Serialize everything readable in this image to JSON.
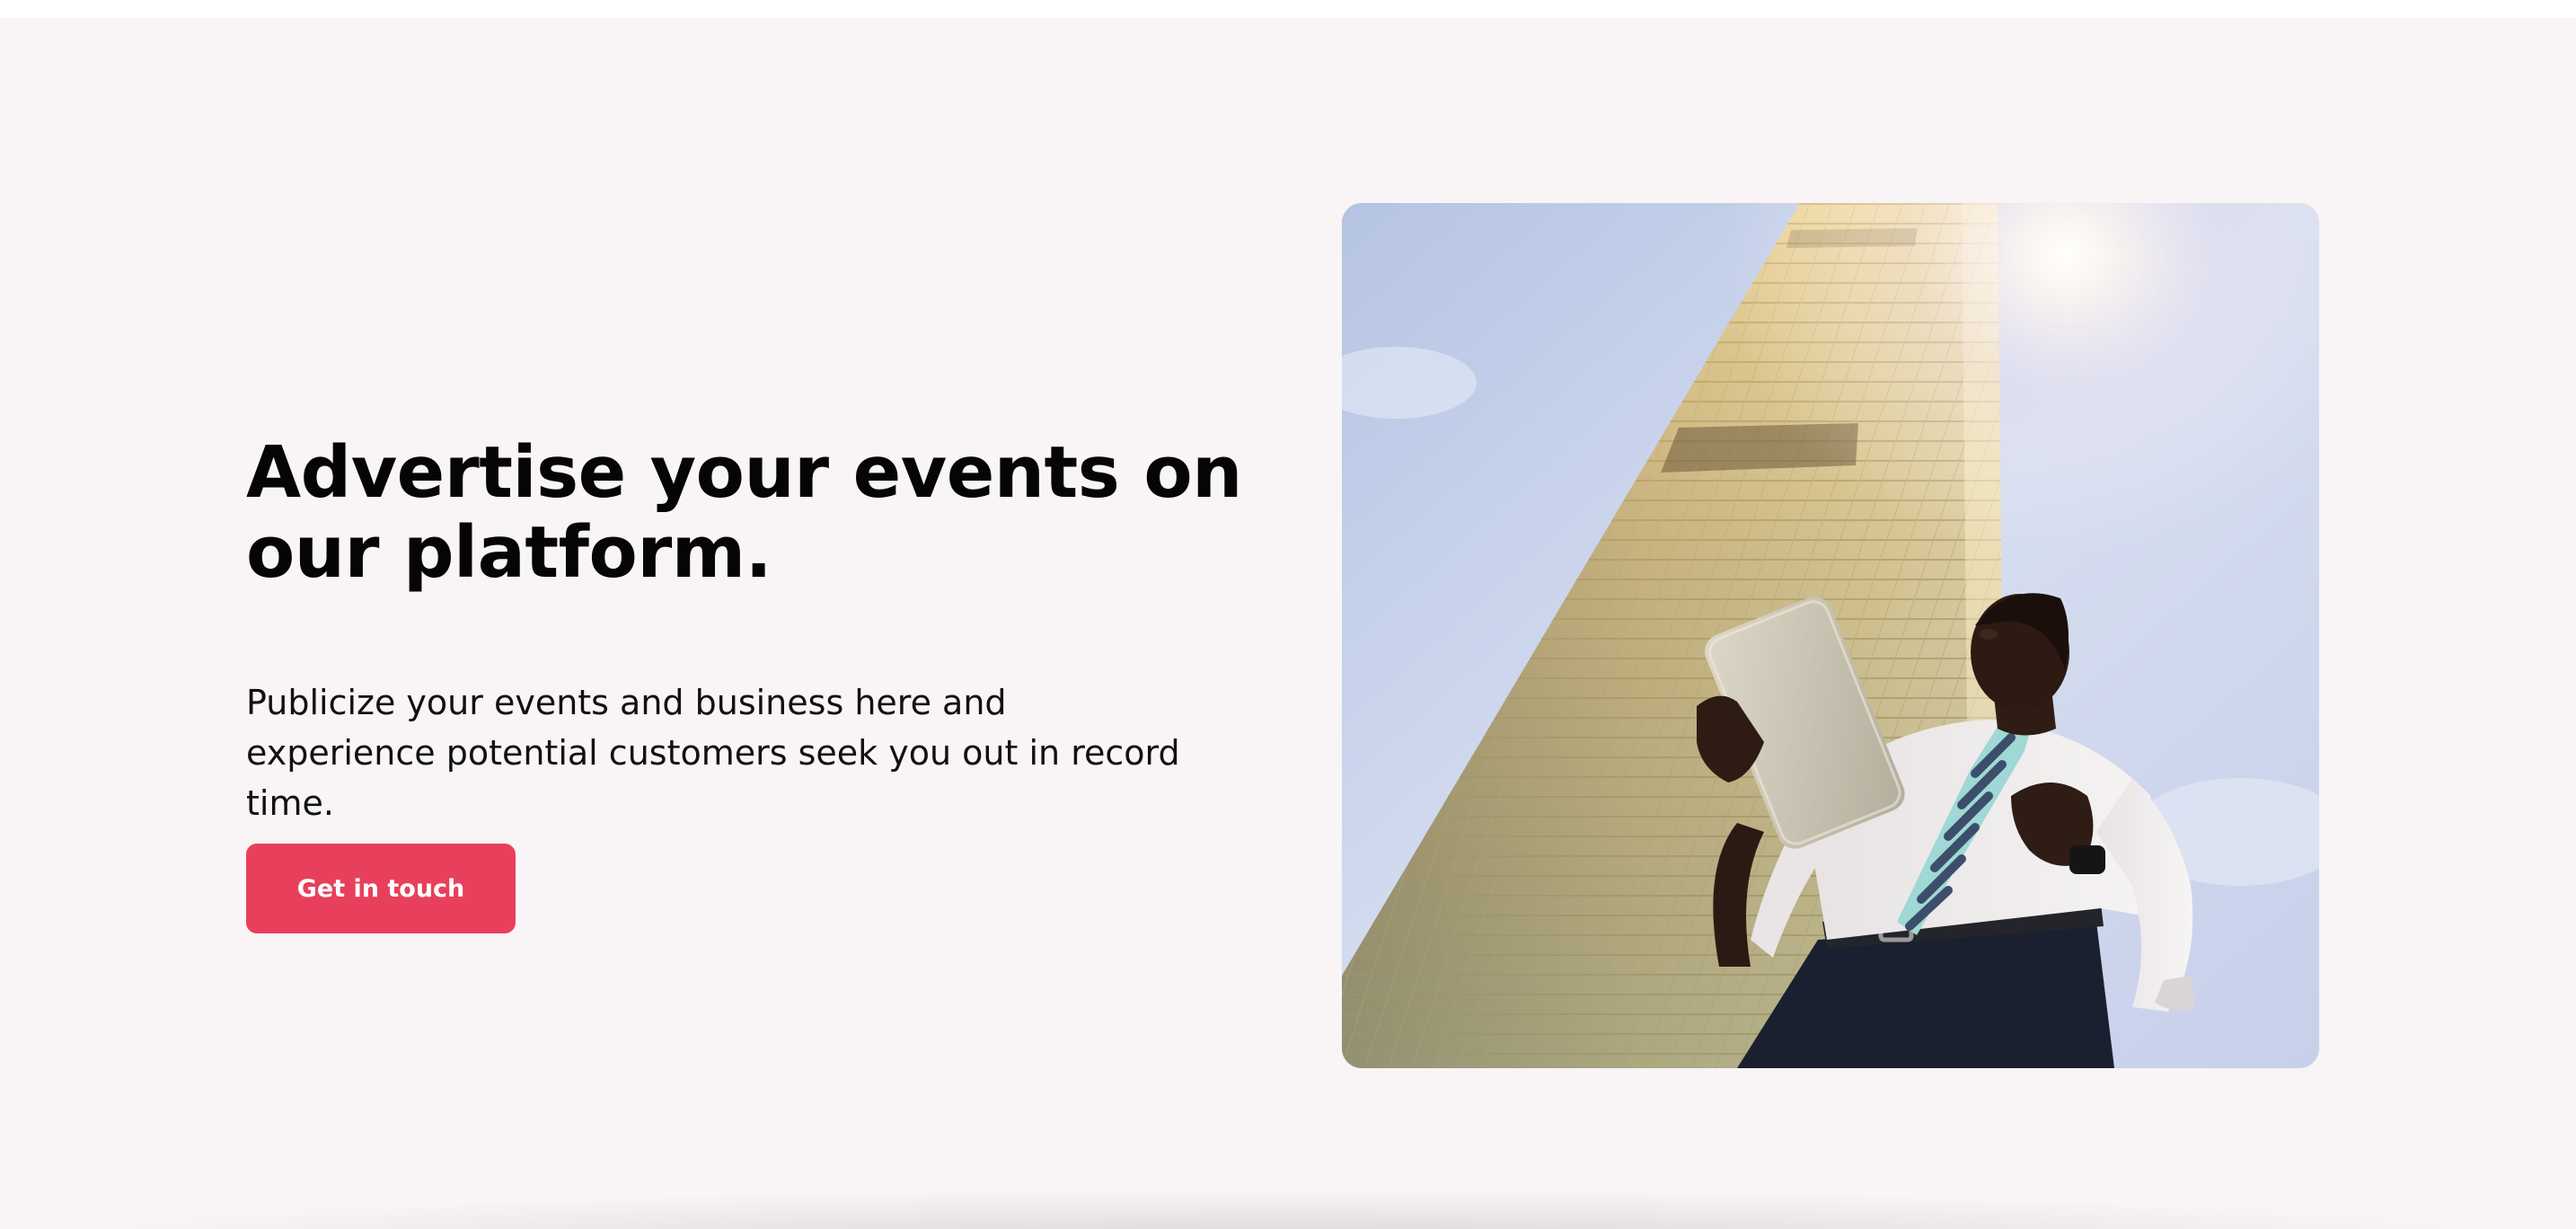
{
  "hero": {
    "title": "Advertise your events on our platform.",
    "subtitle": "Publicize your events and business here and experience potential customers seek you out in record time.",
    "cta_label": "Get in touch"
  },
  "colors": {
    "background": "#f9f4f5",
    "accent": "#e8405c",
    "heading": "#050505"
  }
}
